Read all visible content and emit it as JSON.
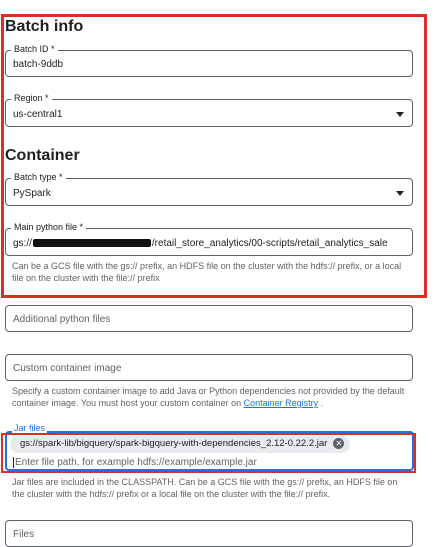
{
  "batch_info": {
    "heading": "Batch info",
    "batch_id": {
      "label": "Batch ID *",
      "value": "batch-9ddb"
    },
    "region": {
      "label": "Region *",
      "value": "us-central1"
    }
  },
  "container": {
    "heading": "Container",
    "batch_type": {
      "label": "Batch type *",
      "value": "PySpark"
    },
    "main_python_file": {
      "label": "Main python file *",
      "value_prefix": "gs://",
      "value_suffix": "/retail_store_analytics/00-scripts/retail_analytics_sale",
      "hint": "Can be a GCS file with the gs:// prefix, an HDFS file on the cluster with the hdfs:// prefix, or a local file on the cluster with the file:// prefix"
    }
  },
  "additional_python_files": {
    "placeholder": "Additional python files"
  },
  "custom_container_image": {
    "placeholder": "Custom container image",
    "hint_prefix": "Specify a custom container image to add Java or Python dependencies not provided by the default container image. You must host your custom container on ",
    "hint_link": "Container Registry",
    "hint_suffix": " ."
  },
  "jar_files": {
    "label": "Jar files",
    "chip": "gs://spark-lib/bigquery/spark-bigquery-with-dependencies_2.12-0.22.2.jar",
    "placeholder": "Enter file path, for example hdfs://example/example.jar",
    "hint": "Jar files are included in the CLASSPATH. Can be a GCS file with the gs:// prefix, an HDFS file on the cluster with the hdfs:// prefix or a local file on the cluster with the file:// prefix."
  },
  "files": {
    "label": "Files"
  },
  "colors": {
    "highlight_red": "#d93025",
    "focus_blue": "#1a73e8",
    "link": "#1a73e8"
  }
}
